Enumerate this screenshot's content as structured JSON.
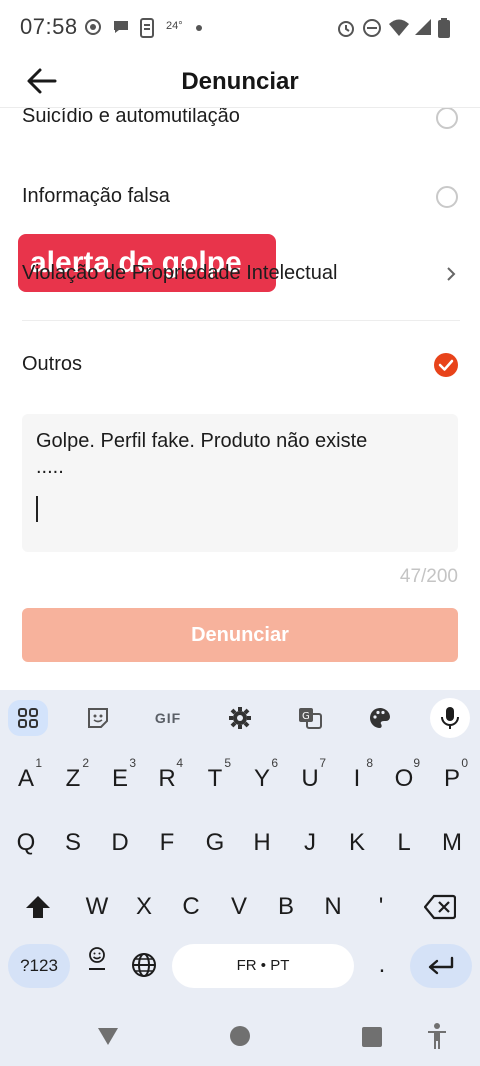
{
  "status_bar": {
    "time": "07:58",
    "temperature": "24°",
    "icons": [
      "target-icon",
      "chat-bubble-icon",
      "phone-icon",
      "alarm-icon",
      "do-not-disturb-icon",
      "wifi-icon",
      "signal-icon",
      "battery-icon"
    ]
  },
  "header": {
    "title": "Denunciar",
    "back_icon": "arrow-left-icon"
  },
  "options": [
    {
      "label": "Suicídio e automutilação",
      "control": "radio",
      "selected": false
    },
    {
      "label": "Informação falsa",
      "control": "radio",
      "selected": false
    },
    {
      "label": "Violação de Propriedade Intelectual",
      "control": "chevron"
    },
    {
      "label": "Outros",
      "control": "radio",
      "selected": true
    }
  ],
  "overlay_badge": "alerta de golpe",
  "details": {
    "line1": "Golpe. Perfil fake. Produto não existe",
    "line2": ".....",
    "counter": "47/200"
  },
  "submit_label": "Denunciar",
  "keyboard": {
    "row1": [
      {
        "k": "A",
        "h": "1"
      },
      {
        "k": "Z",
        "h": "2"
      },
      {
        "k": "E",
        "h": "3"
      },
      {
        "k": "R",
        "h": "4"
      },
      {
        "k": "T",
        "h": "5"
      },
      {
        "k": "Y",
        "h": "6"
      },
      {
        "k": "U",
        "h": "7"
      },
      {
        "k": "I",
        "h": "8"
      },
      {
        "k": "O",
        "h": "9"
      },
      {
        "k": "P",
        "h": "0"
      }
    ],
    "row2": [
      "Q",
      "S",
      "D",
      "F",
      "G",
      "H",
      "J",
      "K",
      "L",
      "M"
    ],
    "row3": [
      "W",
      "X",
      "C",
      "V",
      "B",
      "N",
      "'"
    ],
    "symbols_label": "?123",
    "space_label": "FR • PT",
    "period_label": ".",
    "gif_label": "GIF",
    "colors": {
      "accent": "#e8431a",
      "badge": "#e8344b",
      "keyboard_bg": "#e9edf5"
    }
  }
}
